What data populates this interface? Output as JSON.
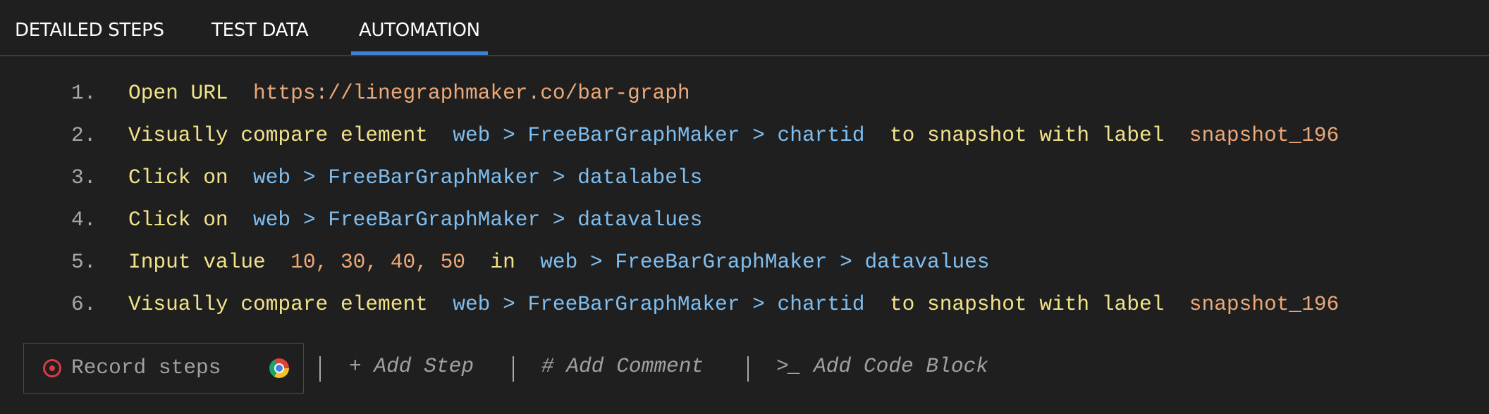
{
  "tabs": [
    {
      "label": "DETAILED STEPS",
      "active": false
    },
    {
      "label": "TEST DATA",
      "active": false
    },
    {
      "label": "AUTOMATION",
      "active": true
    }
  ],
  "steps": [
    {
      "num": "1.",
      "parts": [
        {
          "kind": "kw",
          "text": "Open URL"
        },
        {
          "kind": "val",
          "text": "https://linegraphmaker.co/bar-graph"
        }
      ]
    },
    {
      "num": "2.",
      "parts": [
        {
          "kind": "kw",
          "text": "Visually compare element"
        },
        {
          "kind": "ref",
          "text": "web > FreeBarGraphMaker > chartid"
        },
        {
          "kind": "kw",
          "text": "to snapshot with label"
        },
        {
          "kind": "val",
          "text": "snapshot_196"
        }
      ]
    },
    {
      "num": "3.",
      "parts": [
        {
          "kind": "kw",
          "text": "Click on"
        },
        {
          "kind": "ref",
          "text": "web > FreeBarGraphMaker > datalabels"
        }
      ]
    },
    {
      "num": "4.",
      "parts": [
        {
          "kind": "kw",
          "text": "Click on"
        },
        {
          "kind": "ref",
          "text": "web > FreeBarGraphMaker > datavalues"
        }
      ]
    },
    {
      "num": "5.",
      "parts": [
        {
          "kind": "kw",
          "text": "Input value"
        },
        {
          "kind": "val",
          "text": "10, 30, 40, 50"
        },
        {
          "kind": "kw",
          "text": "in"
        },
        {
          "kind": "ref",
          "text": "web > FreeBarGraphMaker > datavalues"
        }
      ]
    },
    {
      "num": "6.",
      "parts": [
        {
          "kind": "kw",
          "text": "Visually compare element"
        },
        {
          "kind": "ref",
          "text": "web > FreeBarGraphMaker > chartid"
        },
        {
          "kind": "kw",
          "text": "to snapshot with label"
        },
        {
          "kind": "val",
          "text": "snapshot_196"
        }
      ]
    }
  ],
  "toolbar": {
    "record_label": "Record steps",
    "record_icon": "record-icon",
    "browser_icon": "chrome-icon",
    "add_step": "+ Add Step",
    "add_comment": "# Add Comment",
    "add_code_block": ">_ Add Code Block"
  },
  "colors": {
    "background": "#1f1f1f",
    "active_tab_underline": "#3b82d6",
    "keyword": "#f2e38a",
    "reference": "#7fbef0",
    "value": "#eba878",
    "step_number": "#a8a8a8",
    "record": "#d93a46"
  }
}
